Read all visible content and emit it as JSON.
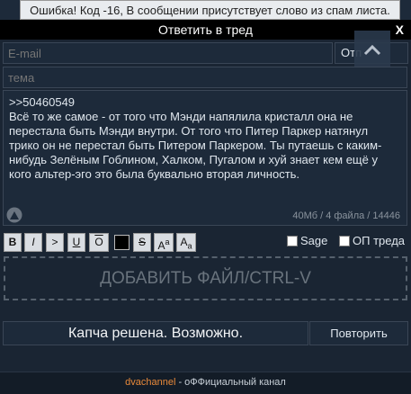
{
  "toast": {
    "text": "Ошибка! Код -16, В сообщении присутствует слово из спам листа."
  },
  "titlebar": {
    "title": "Ответить в тред",
    "close": "X"
  },
  "form": {
    "email_placeholder": "E-mail",
    "options_button": "Отп",
    "subject_placeholder": "тема",
    "message": {
      "reply_ref": ">>50460549",
      "text": "Всё то же самое - от того что Мэнди напялила кристалл она не перестала быть Мэнди внутри. От того что Питер Паркер натянул трико он не перестал быть Питером Паркером. Ты путаешь с каким-нибудь Зелёным Гоблином, Халком, Пугалом и хуй знает кем ещё у кого альтер-эго это была буквально вторая личность."
    },
    "limits": "40Мб / 4 файла / 14446"
  },
  "toolbar": {
    "bold": "B",
    "italic": "I",
    "quote": ">",
    "underline": "U",
    "overline": "O",
    "strike": "S",
    "sup_base": "A",
    "sup": "a",
    "sub_base": "A",
    "sub": "a",
    "sage": "Sage",
    "op": "ОП треда"
  },
  "dropzone": {
    "label": "ДОБАВИТЬ ФАЙЛ/CTRL-V"
  },
  "captcha": {
    "status": "Капча решена. Возможно.",
    "retry": "Повторить"
  },
  "footer": {
    "link": "dvachannel",
    "text": " - оФФициальный канал"
  },
  "colors": {
    "accent": "#e8893a",
    "panel": "#1a2533"
  }
}
